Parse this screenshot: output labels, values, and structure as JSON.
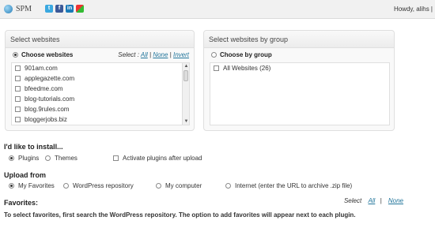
{
  "topbar": {
    "app_name": "SPM",
    "greeting": "Howdy, alihs |",
    "social_icons": [
      "twitter-icon",
      "facebook-icon",
      "linkedin-icon",
      "google-icon"
    ]
  },
  "websites_panel": {
    "title": "Select websites",
    "radio_label": "Choose websites",
    "select_label": "Select :",
    "select_all": "All",
    "select_none": "None",
    "select_invert": "Invert",
    "sep": "|",
    "items": [
      "901am.com",
      "applegazette.com",
      "bfeedme.com",
      "blog-tutorials.com",
      "blog.9rules.com",
      "bloggerjobs.biz"
    ]
  },
  "groups_panel": {
    "title": "Select websites by group",
    "radio_label": "Choose by group",
    "items": [
      "All Websites (26)"
    ]
  },
  "install": {
    "title": "I'd like to install...",
    "options": [
      "Plugins",
      "Themes"
    ],
    "activate_label": "Activate plugins after upload"
  },
  "upload": {
    "title": "Upload from",
    "options": [
      "My Favorites",
      "WordPress repository",
      "My computer",
      "Internet (enter the URL to archive .zip file)"
    ]
  },
  "favorites": {
    "title": "Favorites:",
    "select_label": "Select",
    "select_all": "All",
    "select_none": "None",
    "sep": "|",
    "description": "To select favorites, first search the WordPress repository. The option to add favorites will appear next to each plugin."
  }
}
